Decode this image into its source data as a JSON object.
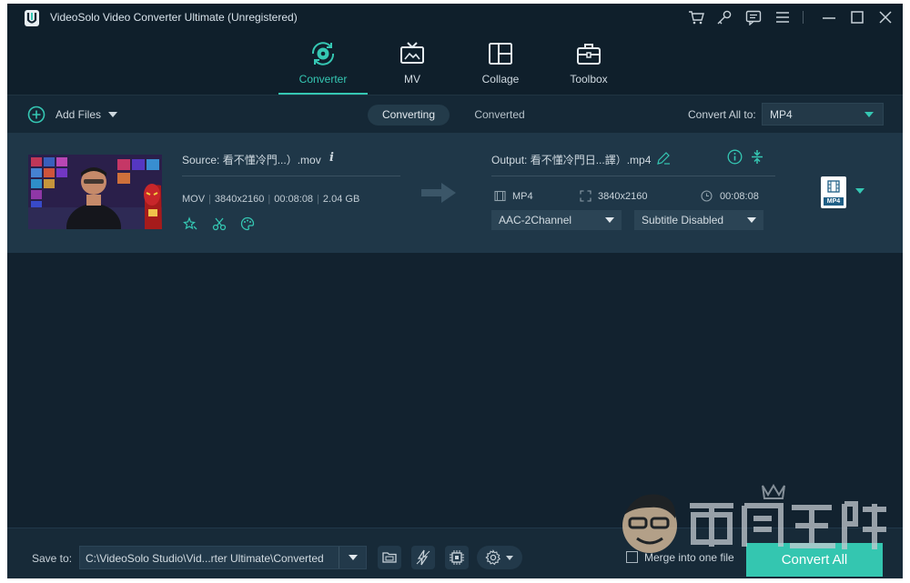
{
  "window": {
    "title": "VideoSolo Video Converter Ultimate (Unregistered)"
  },
  "nav": {
    "tabs": [
      {
        "label": "Converter",
        "icon": "converter-disc-icon"
      },
      {
        "label": "MV",
        "icon": "tv-icon"
      },
      {
        "label": "Collage",
        "icon": "collage-grid-icon"
      },
      {
        "label": "Toolbox",
        "icon": "toolbox-icon"
      }
    ],
    "active": "Converter"
  },
  "toolbar": {
    "add_files_label": "Add Files",
    "tab_converting": "Converting",
    "tab_converted": "Converted",
    "convert_all_to_label": "Convert All to:",
    "convert_all_format": "MP4"
  },
  "file": {
    "source_label": "Source: 看不懂冷門...）.mov",
    "format": "MOV",
    "resolution": "3840x2160",
    "duration": "00:08:08",
    "size": "2.04 GB",
    "output_label": "Output: 看不懂冷門日...譯）.mp4",
    "output_format": "MP4",
    "output_resolution": "3840x2160",
    "output_duration": "00:08:08",
    "audio_track": "AAC-2Channel",
    "subtitle": "Subtitle Disabled",
    "format_tile_label": "MP4"
  },
  "footer": {
    "save_to_label": "Save to:",
    "save_path": "C:\\VideoSolo Studio\\Vid...rter Ultimate\\Converted",
    "merge_label": "Merge into one file",
    "convert_all_button": "Convert All"
  },
  "colors": {
    "accent": "#35c7b3",
    "background": "#12222f",
    "row_background": "#1f3748",
    "convert_button": "#34c6b0"
  }
}
